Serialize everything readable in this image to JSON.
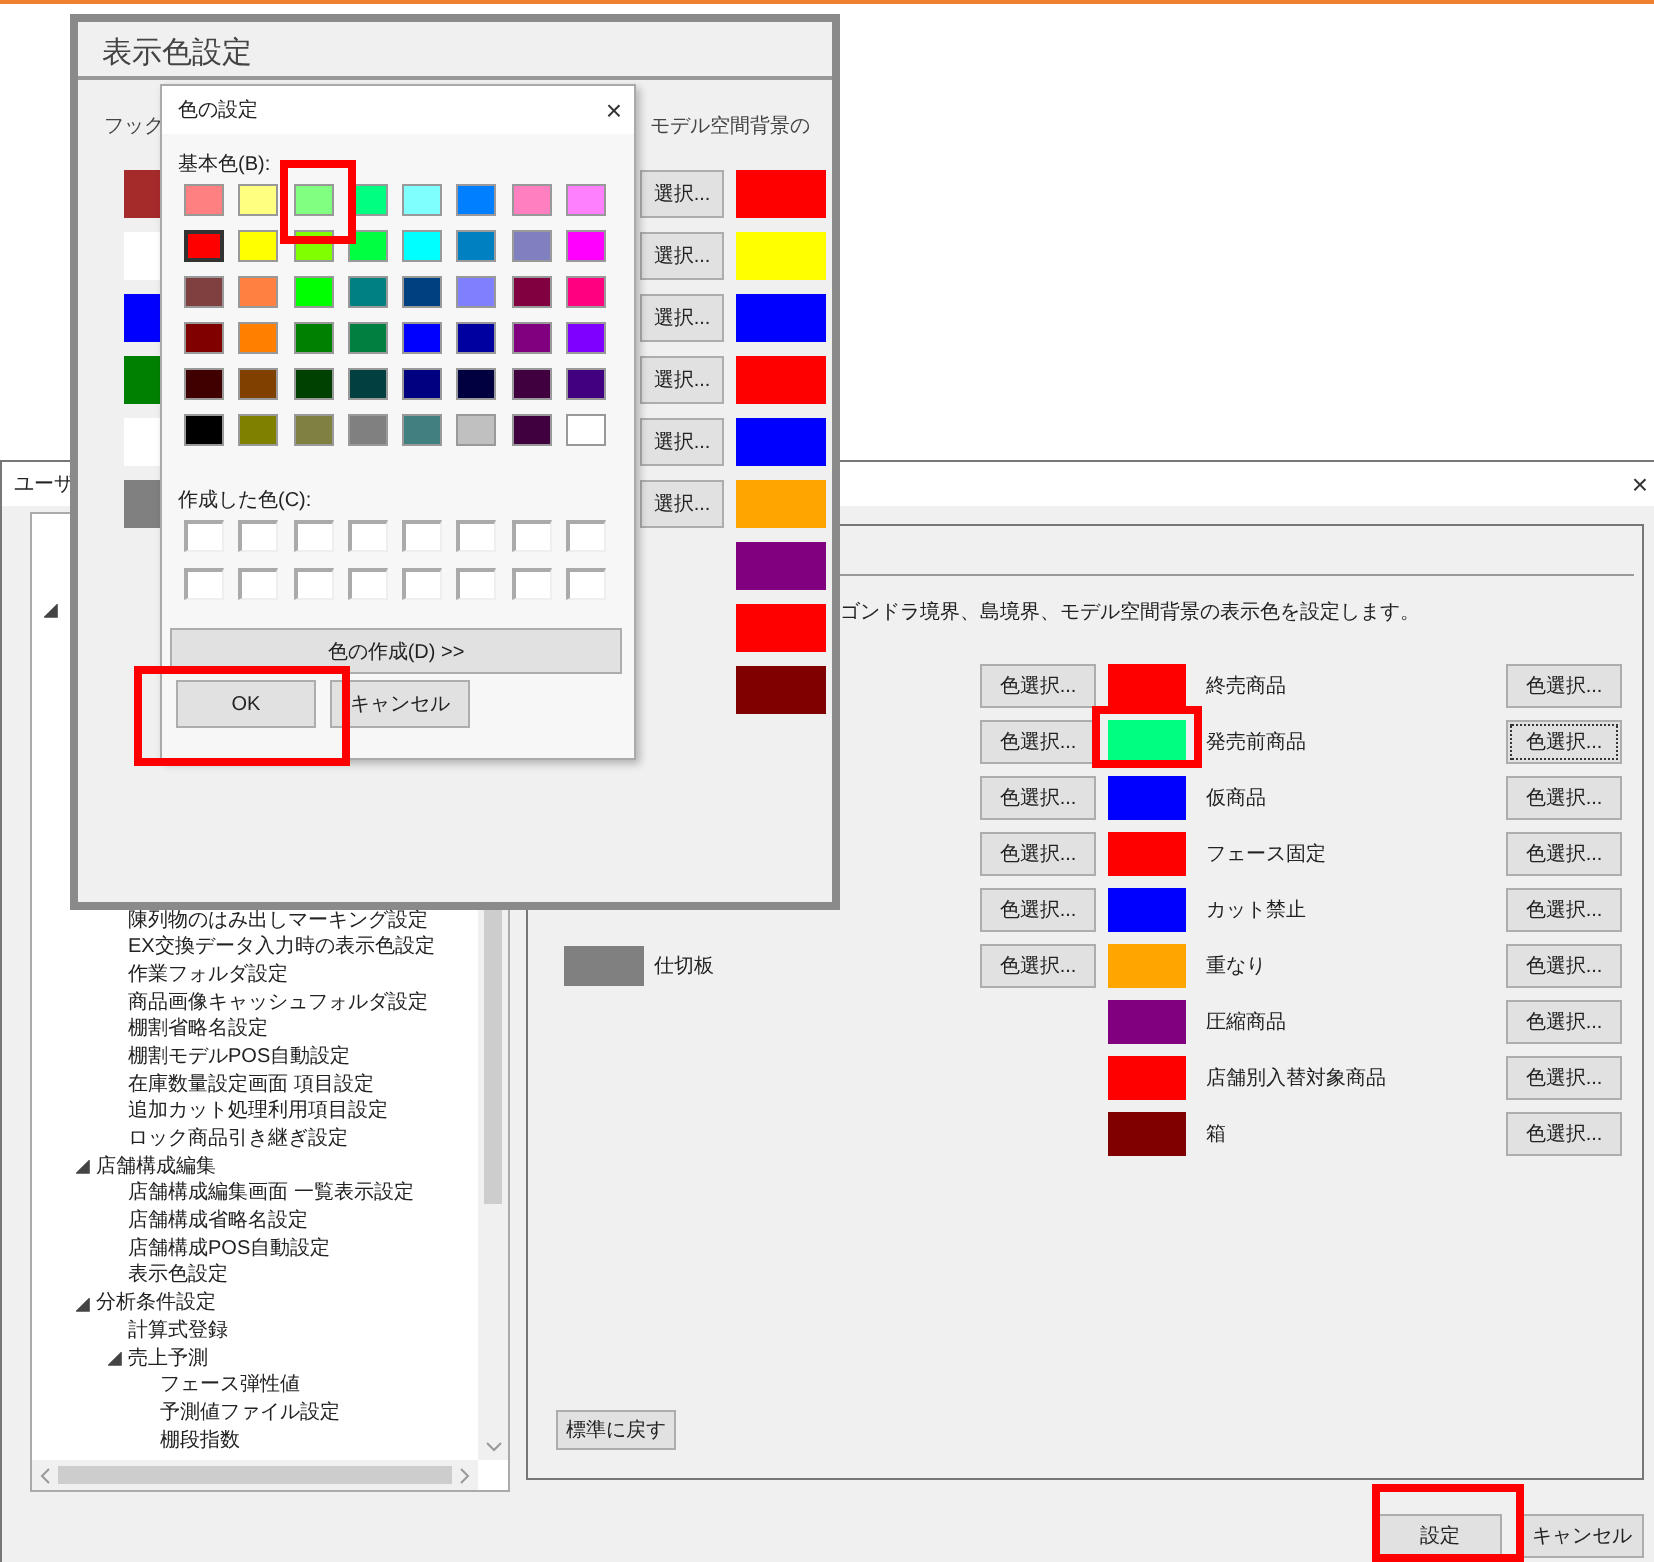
{
  "zoom_window": {
    "title": "表示色設定",
    "caption_left": "フック",
    "caption_right": "モデル空間背景の",
    "left_swatches": [
      {
        "color": "#a52a2a"
      },
      {
        "color": "#ffffff"
      },
      {
        "color": "#0000ff"
      },
      {
        "color": "#008000"
      },
      {
        "color": "#ffffff"
      },
      {
        "color": "#808080"
      }
    ],
    "select_buttons": [
      "選択...",
      "選択...",
      "選択...",
      "選択...",
      "選択...",
      "選択..."
    ],
    "right_swatches": [
      {
        "color": "#ff0000"
      },
      {
        "color": "#ffff00"
      },
      {
        "color": "#0000ff"
      },
      {
        "color": "#ff0000"
      },
      {
        "color": "#0000ff"
      },
      {
        "color": "#ffa500"
      },
      {
        "color": "#800080"
      },
      {
        "color": "#ff0000"
      },
      {
        "color": "#800000"
      }
    ]
  },
  "color_dialog": {
    "title": "色の設定",
    "close": "×",
    "basic_label": "基本色(B):",
    "basic_colors": [
      {
        "color": "#ff8080",
        "selected": false
      },
      {
        "color": "#ffff80",
        "selected": false
      },
      {
        "color": "#80ff80",
        "selected": false
      },
      {
        "color": "#00ff80",
        "selected": false
      },
      {
        "color": "#80ffff",
        "selected": false
      },
      {
        "color": "#0080ff",
        "selected": false
      },
      {
        "color": "#ff80c0",
        "selected": false
      },
      {
        "color": "#ff80ff",
        "selected": false
      },
      {
        "color": "#ff0000",
        "selected": true
      },
      {
        "color": "#ffff00",
        "selected": false
      },
      {
        "color": "#80ff00",
        "selected": false
      },
      {
        "color": "#00ff40",
        "selected": false
      },
      {
        "color": "#00ffff",
        "selected": false
      },
      {
        "color": "#0080c0",
        "selected": false
      },
      {
        "color": "#8080c0",
        "selected": false
      },
      {
        "color": "#ff00ff",
        "selected": false
      },
      {
        "color": "#804040",
        "selected": false
      },
      {
        "color": "#ff8040",
        "selected": false
      },
      {
        "color": "#00ff00",
        "selected": false
      },
      {
        "color": "#008080",
        "selected": false
      },
      {
        "color": "#004080",
        "selected": false
      },
      {
        "color": "#8080ff",
        "selected": false
      },
      {
        "color": "#800040",
        "selected": false
      },
      {
        "color": "#ff0080",
        "selected": false
      },
      {
        "color": "#800000",
        "selected": false
      },
      {
        "color": "#ff8000",
        "selected": false
      },
      {
        "color": "#008000",
        "selected": false
      },
      {
        "color": "#008040",
        "selected": false
      },
      {
        "color": "#0000ff",
        "selected": false
      },
      {
        "color": "#0000a0",
        "selected": false
      },
      {
        "color": "#800080",
        "selected": false
      },
      {
        "color": "#8000ff",
        "selected": false
      },
      {
        "color": "#400000",
        "selected": false
      },
      {
        "color": "#804000",
        "selected": false
      },
      {
        "color": "#004000",
        "selected": false
      },
      {
        "color": "#004040",
        "selected": false
      },
      {
        "color": "#000080",
        "selected": false
      },
      {
        "color": "#000040",
        "selected": false
      },
      {
        "color": "#400040",
        "selected": false
      },
      {
        "color": "#400080",
        "selected": false
      },
      {
        "color": "#000000",
        "selected": false
      },
      {
        "color": "#808000",
        "selected": false
      },
      {
        "color": "#808040",
        "selected": false
      },
      {
        "color": "#808080",
        "selected": false
      },
      {
        "color": "#408080",
        "selected": false
      },
      {
        "color": "#c0c0c0",
        "selected": false
      },
      {
        "color": "#400040",
        "selected": false
      },
      {
        "color": "#ffffff",
        "selected": false
      }
    ],
    "custom_label": "作成した色(C):",
    "custom_colors": [
      {
        "color": "#ffffff"
      },
      {
        "color": "#ffffff"
      },
      {
        "color": "#ffffff"
      },
      {
        "color": "#ffffff"
      },
      {
        "color": "#ffffff"
      },
      {
        "color": "#ffffff"
      },
      {
        "color": "#ffffff"
      },
      {
        "color": "#ffffff"
      },
      {
        "color": "#ffffff"
      },
      {
        "color": "#ffffff"
      },
      {
        "color": "#ffffff"
      },
      {
        "color": "#ffffff"
      },
      {
        "color": "#ffffff"
      },
      {
        "color": "#ffffff"
      },
      {
        "color": "#ffffff"
      },
      {
        "color": "#ffffff"
      }
    ],
    "define_button": "色の作成(D) >>",
    "ok_button": "OK",
    "cancel_button": "キャンセル"
  },
  "main_window": {
    "title": "ユーザ",
    "close": "×",
    "tree": [
      {
        "expanded": true,
        "children": [
          {
            "children": [
              {
                "label": "陳列物のはみ出しマーキング設定"
              },
              {
                "label": "EX交換データ入力時の表示色設定"
              },
              {
                "label": "作業フォルダ設定"
              },
              {
                "label": "商品画像キャッシュフォルダ設定"
              },
              {
                "label": "棚割省略名設定"
              },
              {
                "label": "棚割モデルPOS自動設定"
              },
              {
                "label": "在庫数量設定画面 項目設定"
              },
              {
                "label": "追加カット処理利用項目設定"
              },
              {
                "label": "ロック商品引き継ぎ設定"
              }
            ]
          },
          {
            "label": "店舗構成編集",
            "expanded": true,
            "children": [
              {
                "label": "店舗構成編集画面 一覧表示設定"
              },
              {
                "label": "店舗構成省略名設定"
              },
              {
                "label": "店舗構成POS自動設定"
              },
              {
                "label": "表示色設定"
              }
            ]
          },
          {
            "label": "分析条件設定",
            "expanded": true,
            "children": [
              {
                "label": "計算式登録"
              },
              {
                "label": "売上予測",
                "expanded": true,
                "children": [
                  {
                    "label": "フェース弾性値"
                  },
                  {
                    "label": "予測値ファイル設定"
                  },
                  {
                    "label": "棚段指数"
                  }
                ]
              }
            ]
          }
        ]
      }
    ],
    "description": "ゴンドラ境界、島境界、モデル空間背景の表示色を設定します。",
    "left_rows": [
      {
        "button": "色選択..."
      },
      {
        "button": "色選択..."
      },
      {
        "button": "色選択..."
      },
      {
        "button": "色選択..."
      },
      {
        "button": "色選択..."
      },
      {
        "button": "色選択...",
        "label": "仕切板",
        "color": "#808080"
      }
    ],
    "items": [
      {
        "label": "終売商品",
        "color": "#ff0000",
        "button": "色選択...",
        "focused": false
      },
      {
        "label": "発売前商品",
        "color": "#00ff80",
        "button": "色選択...",
        "focused": true
      },
      {
        "label": "仮商品",
        "color": "#0000ff",
        "button": "色選択...",
        "focused": false
      },
      {
        "label": "フェース固定",
        "color": "#ff0000",
        "button": "色選択...",
        "focused": false
      },
      {
        "label": "カット禁止",
        "color": "#0000ff",
        "button": "色選択...",
        "focused": false
      },
      {
        "label": "重なり",
        "color": "#ffa500",
        "button": "色選択...",
        "focused": false
      },
      {
        "label": "圧縮商品",
        "color": "#800080",
        "button": "色選択...",
        "focused": false
      },
      {
        "label": "店舗別入替対象商品",
        "color": "#ff0000",
        "button": "色選択...",
        "focused": false
      },
      {
        "label": "箱",
        "color": "#800000",
        "button": "色選択...",
        "focused": false
      }
    ],
    "reset_button": "標準に戻す",
    "ok_button": "設定",
    "cancel_button": "キャンセル"
  }
}
